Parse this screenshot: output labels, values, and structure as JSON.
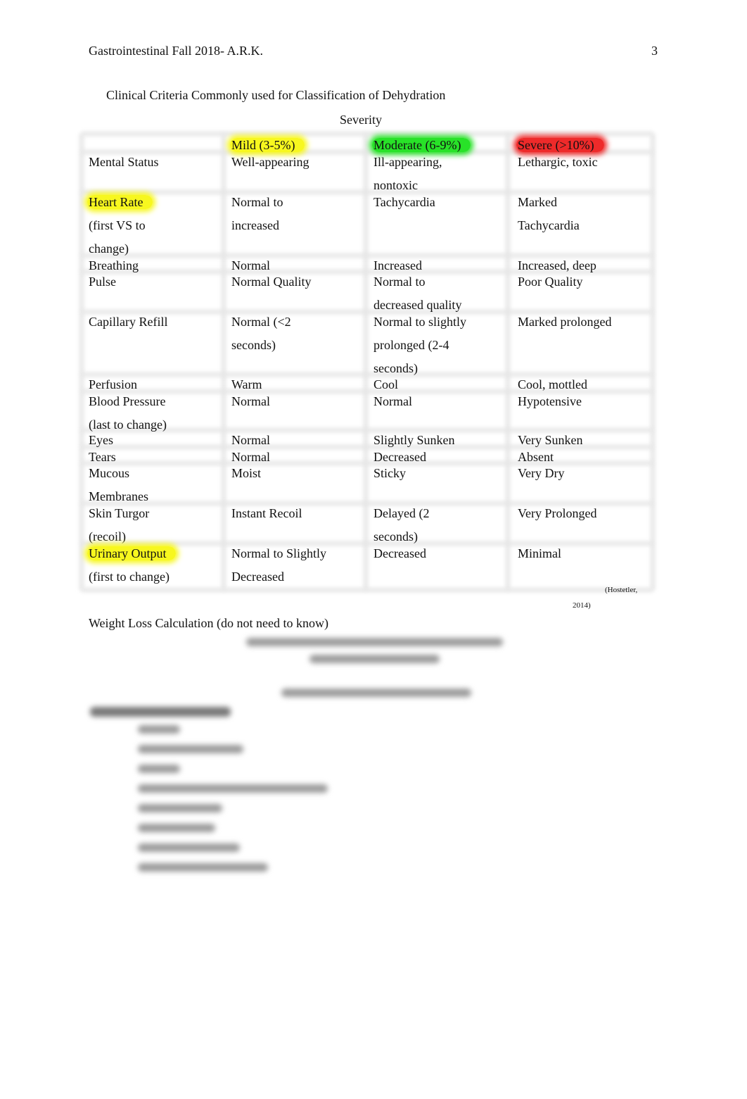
{
  "header": {
    "title": "Gastrointestinal Fall 2018- A.R.K.",
    "page_number": "3"
  },
  "table": {
    "title": "Clinical Criteria Commonly used for Classification of Dehydration",
    "subtitle": "Severity",
    "columns": [
      {
        "label": "",
        "highlight": null
      },
      {
        "label": "Mild (3-5%)",
        "highlight": "#f7f71f"
      },
      {
        "label": "Moderate (6-9%)",
        "highlight": "#28e228"
      },
      {
        "label": "Severe (>10%)",
        "highlight": "#ee2a2a"
      }
    ],
    "rows": [
      {
        "criterion": [
          "Mental Status"
        ],
        "mild": [
          "Well-appearing"
        ],
        "moderate": [
          "Ill-appearing,",
          "nontoxic"
        ],
        "severe": [
          "Lethargic, toxic"
        ],
        "highlight": false
      },
      {
        "criterion": [
          "Heart Rate",
          "(first VS to",
          "change)"
        ],
        "mild": [
          "Normal to",
          "increased"
        ],
        "moderate": [
          "Tachycardia"
        ],
        "severe": [
          "Marked",
          "Tachycardia"
        ],
        "highlight": true
      },
      {
        "criterion": [
          "Breathing"
        ],
        "mild": [
          "Normal"
        ],
        "moderate": [
          "Increased"
        ],
        "severe": [
          "Increased, deep"
        ],
        "highlight": false
      },
      {
        "criterion": [
          "Pulse"
        ],
        "mild": [
          "Normal Quality"
        ],
        "moderate": [
          "Normal to",
          "decreased quality"
        ],
        "severe": [
          "Poor Quality"
        ],
        "highlight": false
      },
      {
        "criterion": [
          "Capillary Refill"
        ],
        "mild": [
          "Normal (<2",
          "seconds)"
        ],
        "moderate": [
          "Normal to slightly",
          "prolonged (2-4",
          "seconds)"
        ],
        "severe": [
          "Marked prolonged"
        ],
        "highlight": false
      },
      {
        "criterion": [
          "Perfusion"
        ],
        "mild": [
          "Warm"
        ],
        "moderate": [
          "Cool"
        ],
        "severe": [
          "Cool, mottled"
        ],
        "highlight": false
      },
      {
        "criterion": [
          "Blood Pressure",
          "(last to change)"
        ],
        "mild": [
          "Normal"
        ],
        "moderate": [
          "Normal"
        ],
        "severe": [
          "Hypotensive"
        ],
        "highlight": false
      },
      {
        "criterion": [
          "Eyes"
        ],
        "mild": [
          "Normal"
        ],
        "moderate": [
          "Slightly Sunken"
        ],
        "severe": [
          "Very Sunken"
        ],
        "highlight": false
      },
      {
        "criterion": [
          "Tears"
        ],
        "mild": [
          "Normal"
        ],
        "moderate": [
          "Decreased"
        ],
        "severe": [
          "Absent"
        ],
        "highlight": false
      },
      {
        "criterion": [
          "Mucous",
          "Membranes"
        ],
        "mild": [
          "Moist"
        ],
        "moderate": [
          "Sticky"
        ],
        "severe": [
          "Very Dry"
        ],
        "highlight": false
      },
      {
        "criterion": [
          "Skin Turgor",
          "(recoil)"
        ],
        "mild": [
          "Instant Recoil"
        ],
        "moderate": [
          "Delayed (2",
          "seconds)"
        ],
        "severe": [
          "Very Prolonged"
        ],
        "highlight": false
      },
      {
        "criterion": [
          "Urinary Output",
          "(first to change)"
        ],
        "mild": [
          "Normal to Slightly",
          "Decreased"
        ],
        "moderate": [
          "Decreased"
        ],
        "severe": [
          "Minimal"
        ],
        "highlight": true
      }
    ],
    "citation_line1": "(Hostetler,",
    "citation_line2": "2014)"
  },
  "weight_loss": {
    "heading": "Weight Loss Calculation (do not need to know)",
    "obscured": true
  }
}
